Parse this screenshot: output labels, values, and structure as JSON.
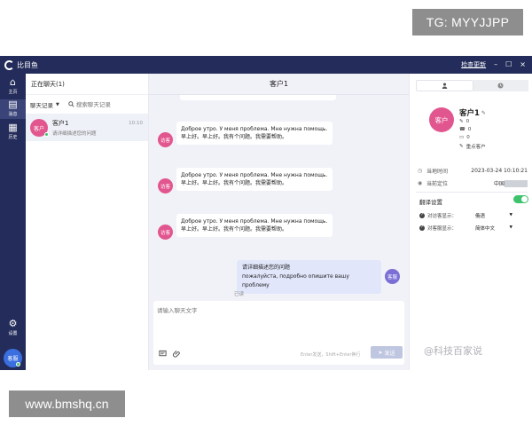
{
  "watermarks": {
    "top": "TG: MYYJJPP",
    "bottom": "www.bmshq.cn",
    "brand": "@科技百家说"
  },
  "app": {
    "name": "比目鱼",
    "update_link": "检查更新",
    "win_min": "–",
    "win_max": "☐",
    "win_close": "×"
  },
  "leftnav": {
    "items": [
      {
        "label": "主页",
        "icon": "home-icon"
      },
      {
        "label": "消息",
        "icon": "message-icon"
      },
      {
        "label": "历史",
        "icon": "history-icon"
      },
      {
        "label": "设置",
        "icon": "settings-icon"
      }
    ],
    "user_avatar": "客服"
  },
  "convlist": {
    "header": "正在聊天(1)",
    "filter_label": "聊天记录",
    "search_placeholder": "搜索聊天记录",
    "items": [
      {
        "avatar": "客户",
        "name": "客户1",
        "preview": "请详细描述您的问题",
        "time": "10:10"
      }
    ]
  },
  "chat": {
    "title": "客户1",
    "messages": [
      {
        "avatar": "访客",
        "line1": "Доброе утро. У меня проблема. Мне нужна помощь.",
        "line2": "早上好。早上好。我有个问题。我需要帮助。"
      },
      {
        "avatar": "访客",
        "line1": "Доброе утро. У меня проблема. Мне нужна помощь.",
        "line2": "早上好。早上好。我有个问题。我需要帮助。"
      },
      {
        "avatar": "访客",
        "line1": "Доброе утро. У меня проблема. Мне нужна помощь.",
        "line2": "早上好。早上好。我有个问题。我需要帮助。"
      }
    ],
    "agent_reply": {
      "line1": "请详细描述您的问题",
      "line2": "пожалуйста, подробно опишите вашу проблему",
      "avatar": "客服"
    },
    "read_status": "已读",
    "input_placeholder": "请输入聊天文字",
    "send_hint": "Enter发送，Shift+Enter换行",
    "send_label": "发送"
  },
  "sidepanel": {
    "profile": {
      "avatar": "客户",
      "name": "客户1",
      "lines": [
        "0",
        "0",
        "0",
        "重点客户"
      ]
    },
    "time_label": "当地时间",
    "time_value": "2023-03-24 10:10:21",
    "location_label": "当前定位",
    "location_value": "中国",
    "translate_title": "翻译设置",
    "visitor_lang_label": "对访客显示：",
    "visitor_lang_value": "俄语",
    "agent_lang_label": "对客服显示：",
    "agent_lang_value": "简体中文",
    "toggle_on": true
  }
}
